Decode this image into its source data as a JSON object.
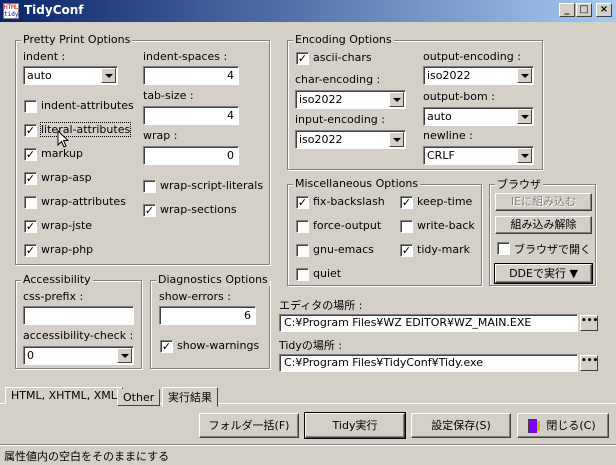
{
  "window": {
    "title": "TidyConf",
    "icon_text_top": "HTML",
    "icon_text_bottom": "tidy"
  },
  "caption_buttons": {
    "minimize": "_",
    "maximize": "□",
    "close": "×"
  },
  "pretty_print": {
    "legend": "Pretty Print Options",
    "indent_label": "indent :",
    "indent_value": "auto",
    "indent_spaces_label": "indent-spaces :",
    "indent_spaces_value": "4",
    "tab_size_label": "tab-size :",
    "tab_size_value": "4",
    "wrap_label": "wrap :",
    "wrap_value": "0",
    "checks": {
      "indent_attributes": {
        "label": "indent-attributes",
        "checked": false
      },
      "literal_attributes": {
        "label": "literal-attributes",
        "checked": true
      },
      "markup": {
        "label": "markup",
        "checked": true
      },
      "wrap_asp": {
        "label": "wrap-asp",
        "checked": true
      },
      "wrap_attributes": {
        "label": "wrap-attributes",
        "checked": false
      },
      "wrap_jste": {
        "label": "wrap-jste",
        "checked": true
      },
      "wrap_php": {
        "label": "wrap-php",
        "checked": true
      },
      "wrap_script_literals": {
        "label": "wrap-script-literals",
        "checked": false
      },
      "wrap_sections": {
        "label": "wrap-sections",
        "checked": true
      }
    }
  },
  "encoding": {
    "legend": "Encoding Options",
    "ascii_chars": {
      "label": "ascii-chars",
      "checked": true
    },
    "char_encoding_label": "char-encoding :",
    "char_encoding_value": "iso2022",
    "input_encoding_label": "input-encoding :",
    "input_encoding_value": "iso2022",
    "output_encoding_label": "output-encoding :",
    "output_encoding_value": "iso2022",
    "output_bom_label": "output-bom :",
    "output_bom_value": "auto",
    "newline_label": "newline :",
    "newline_value": "CRLF"
  },
  "misc": {
    "legend": "Miscellaneous Options",
    "fix_backslash": {
      "label": "fix-backslash",
      "checked": true
    },
    "keep_time": {
      "label": "keep-time",
      "checked": true
    },
    "force_output": {
      "label": "force-output",
      "checked": false
    },
    "write_back": {
      "label": "write-back",
      "checked": false
    },
    "gnu_emacs": {
      "label": "gnu-emacs",
      "checked": false
    },
    "tidy_mark": {
      "label": "tidy-mark",
      "checked": true
    },
    "quiet": {
      "label": "quiet",
      "checked": false
    }
  },
  "browser": {
    "legend": "ブラウザ",
    "embed_ie": "IEに組み込む",
    "unembed": "組み込み解除",
    "open_in_browser": {
      "label": "ブラウザで開く",
      "checked": false
    },
    "dde_execute": "DDEで実行 ▼"
  },
  "accessibility": {
    "legend": "Accessibility",
    "css_prefix_label": "css-prefix :",
    "css_prefix_value": "",
    "check_label": "accessibility-check :",
    "check_value": "0"
  },
  "diagnostics": {
    "legend": "Diagnostics Options",
    "show_errors_label": "show-errors :",
    "show_errors_value": "6",
    "show_warnings": {
      "label": "show-warnings",
      "checked": true
    }
  },
  "paths": {
    "editor_label": "エディタの場所 :",
    "editor_value": "C:¥Program Files¥WZ EDITOR¥WZ_MAIN.EXE",
    "tidy_label": "Tidyの場所 :",
    "tidy_value": "C:¥Program Files¥TidyConf¥Tidy.exe",
    "browse_label": "•••"
  },
  "tabs": [
    {
      "label": "HTML, XHTML, XML",
      "active": false
    },
    {
      "label": "Other",
      "active": true
    },
    {
      "label": "実行結果",
      "active": false
    }
  ],
  "actions": {
    "folder_batch": "フォルダ一括(F)",
    "run_tidy": "Tidy実行",
    "save_settings": "設定保存(S)",
    "close": "閉じる(C)"
  },
  "status_text": "属性値内の空白をそのままにする"
}
